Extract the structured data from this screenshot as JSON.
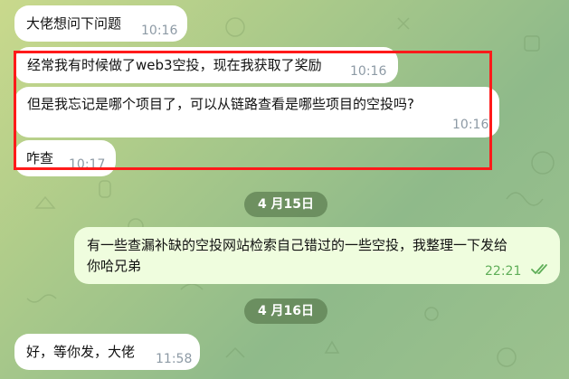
{
  "messages": [
    {
      "text": "大佬想问下问题",
      "time": "10:16"
    },
    {
      "text": "经常我有时候做了web3空投，现在我获取了奖励",
      "time": "10:16"
    },
    {
      "text": "但是我忘记是哪个项目了，可以从链路查看是哪些项目的空投吗?",
      "time": "10:16"
    },
    {
      "text": "咋查",
      "time": "10:17"
    },
    {
      "text_line1": "有一些查漏补缺的空投网站检索自己错过的一些空投，我整理一下发给",
      "text_line2": "你哈兄弟",
      "time": "22:21"
    },
    {
      "text": "好，等你发，大佬",
      "time": "11:58"
    }
  ],
  "dates": {
    "first": "4 月15日",
    "second": "4 月16日"
  },
  "icons": {
    "read_receipt": "double-check-icon"
  },
  "colors": {
    "incoming": "#ffffff",
    "outgoing": "#effdde",
    "highlight": "#ff1a1a",
    "check": "#5fae58"
  }
}
